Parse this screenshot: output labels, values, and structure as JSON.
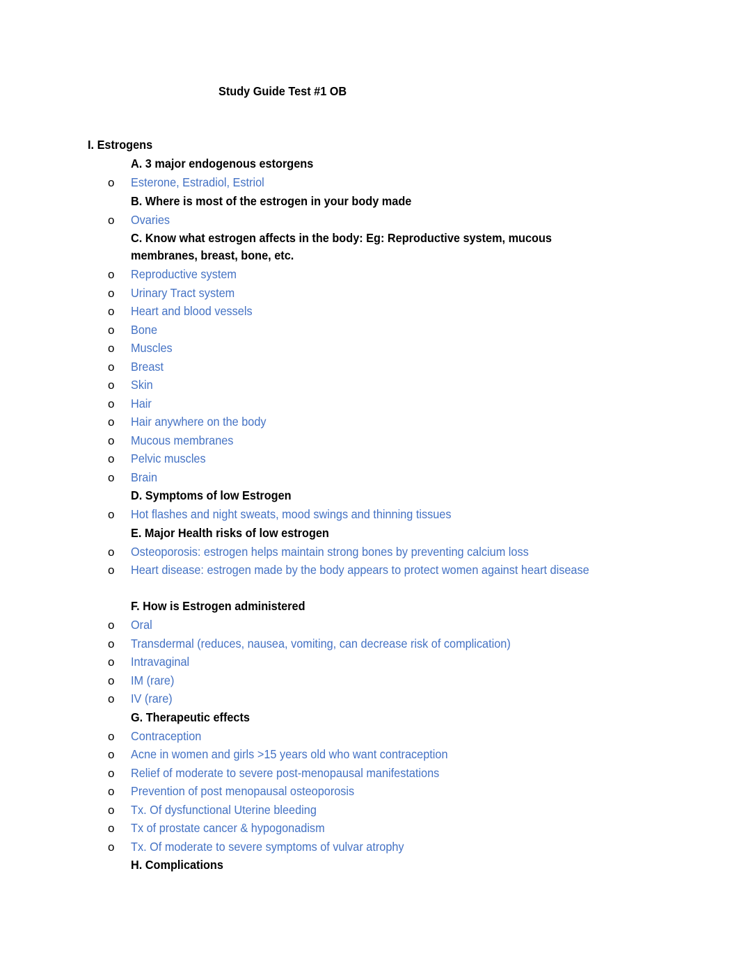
{
  "document": {
    "title": "Study Guide Test #1 OB",
    "section": "I. Estrogens",
    "accent_color": "#4472C4",
    "bullet_glyph": "o",
    "subsections": [
      {
        "heading": "A. 3 major endogenous estorgens",
        "items": [
          "Esterone, Estradiol, Estriol"
        ]
      },
      {
        "heading": "B. Where is most of the estrogen in your body made",
        "items": [
          "Ovaries"
        ]
      },
      {
        "heading": "C. Know what estrogen affects in the body: Eg: Reproductive system, mucous membranes, breast, bone, etc.",
        "items": [
          "Reproductive system",
          "Urinary Tract system",
          "Heart and blood vessels",
          "Bone",
          "Muscles",
          "Breast",
          "Skin",
          "Hair",
          "Hair anywhere on the body",
          "Mucous membranes",
          "Pelvic muscles",
          "Brain"
        ]
      },
      {
        "heading": "D. Symptoms of low Estrogen",
        "items": [
          "Hot flashes and night sweats, mood swings and thinning tissues"
        ]
      },
      {
        "heading": "E. Major Health risks of low estrogen",
        "items": [
          "Osteoporosis: estrogen helps maintain strong bones by preventing calcium loss",
          "Heart disease: estrogen made by the body appears to protect women against heart disease"
        ]
      },
      {
        "heading": "F. How is Estrogen administered",
        "items": [
          "Oral",
          "Transdermal (reduces, nausea, vomiting, can decrease risk of complication)",
          "Intravaginal",
          "IM (rare)",
          "IV (rare)"
        ]
      },
      {
        "heading": "G. Therapeutic effects",
        "items": [
          "Contraception",
          "Acne in women and girls >15 years old who want contraception",
          "Relief of moderate to severe post-menopausal manifestations",
          "Prevention of post menopausal osteoporosis",
          "Tx. Of dysfunctional Uterine bleeding",
          "Tx of prostate cancer & hypogonadism",
          "Tx. Of moderate to severe symptoms of vulvar atrophy"
        ]
      },
      {
        "heading": "H. Complications",
        "items": []
      }
    ]
  }
}
